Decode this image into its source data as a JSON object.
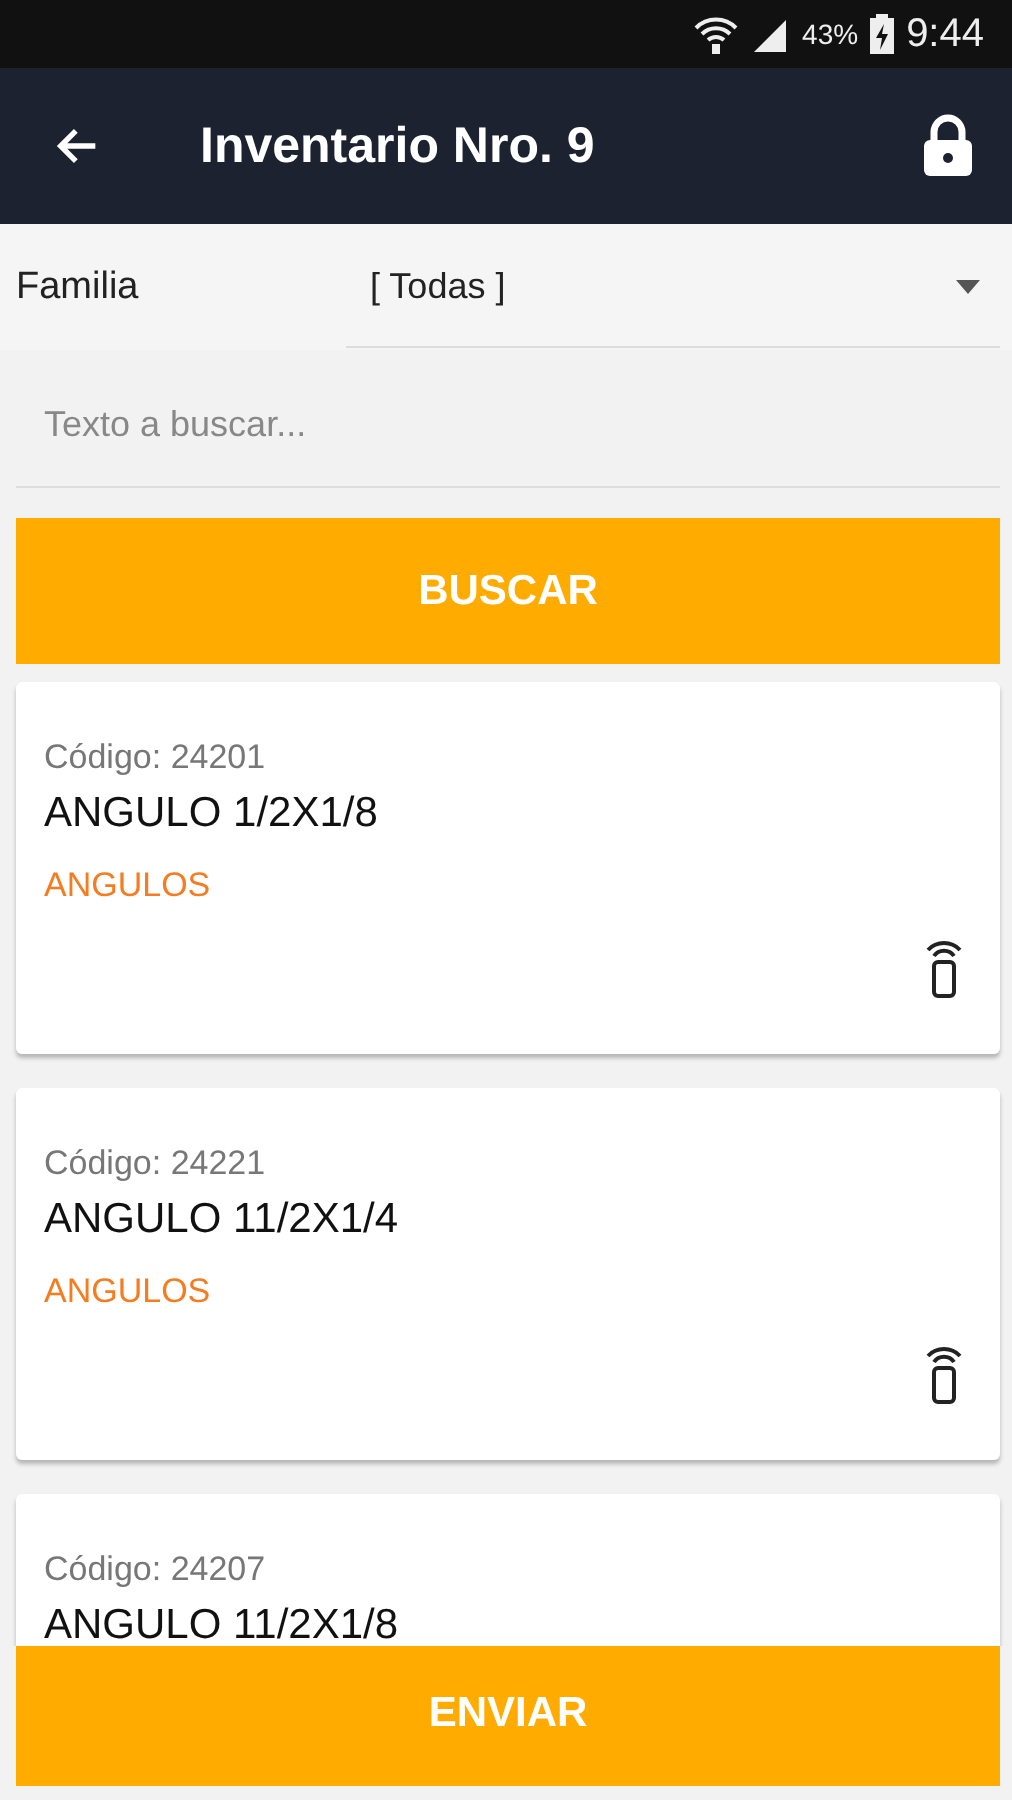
{
  "status_bar": {
    "battery": "43%",
    "time": "9:44"
  },
  "app_bar": {
    "title": "Inventario Nro. 9"
  },
  "filter": {
    "label": "Familia",
    "value": "[ Todas ]"
  },
  "search": {
    "placeholder": "Texto a buscar..."
  },
  "search_button": "BUSCAR",
  "items": [
    {
      "code": "Código: 24201",
      "name": "ANGULO 1/2X1/8",
      "family": "ANGULOS"
    },
    {
      "code": "Código: 24221",
      "name": "ANGULO 11/2X1/4",
      "family": "ANGULOS"
    },
    {
      "code": "Código: 24207",
      "name": "ANGULO 11/2X1/8"
    }
  ],
  "send_button": "ENVIAR"
}
